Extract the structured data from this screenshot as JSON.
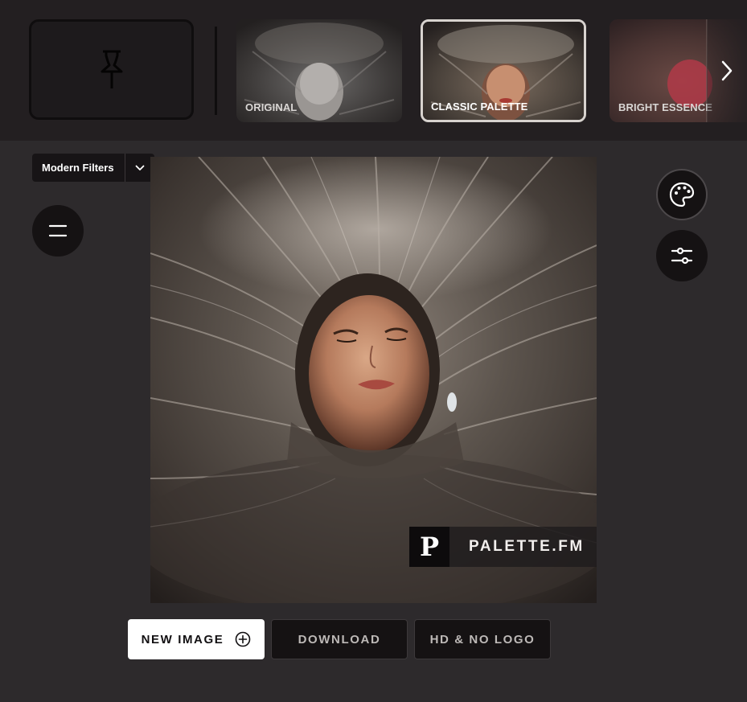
{
  "top_strip": {
    "filters": [
      {
        "label": "ORIGINAL",
        "selected": false,
        "tone": "grayscale"
      },
      {
        "label": "CLASSIC PALETTE",
        "selected": true,
        "tone": "warm"
      },
      {
        "label": "BRIGHT ESSENCE",
        "selected": false,
        "tone": "bright"
      }
    ]
  },
  "toolbar": {
    "filter_category": "Modern Filters"
  },
  "watermark": {
    "logo_letter": "P",
    "text": "PALETTE.FM"
  },
  "actions": {
    "new_image": "NEW IMAGE",
    "download": "DOWNLOAD",
    "hd_no_logo": "HD & NO LOGO"
  },
  "colors": {
    "background": "#2d2a2c",
    "topbar": "#231f21",
    "selected_border": "#d8d3cf",
    "button_dark": "#151213"
  },
  "icons": [
    "pin-icon",
    "chevron-right-icon",
    "chevron-down-icon",
    "menu-icon",
    "palette-icon",
    "sliders-icon",
    "plus-circle-icon"
  ]
}
